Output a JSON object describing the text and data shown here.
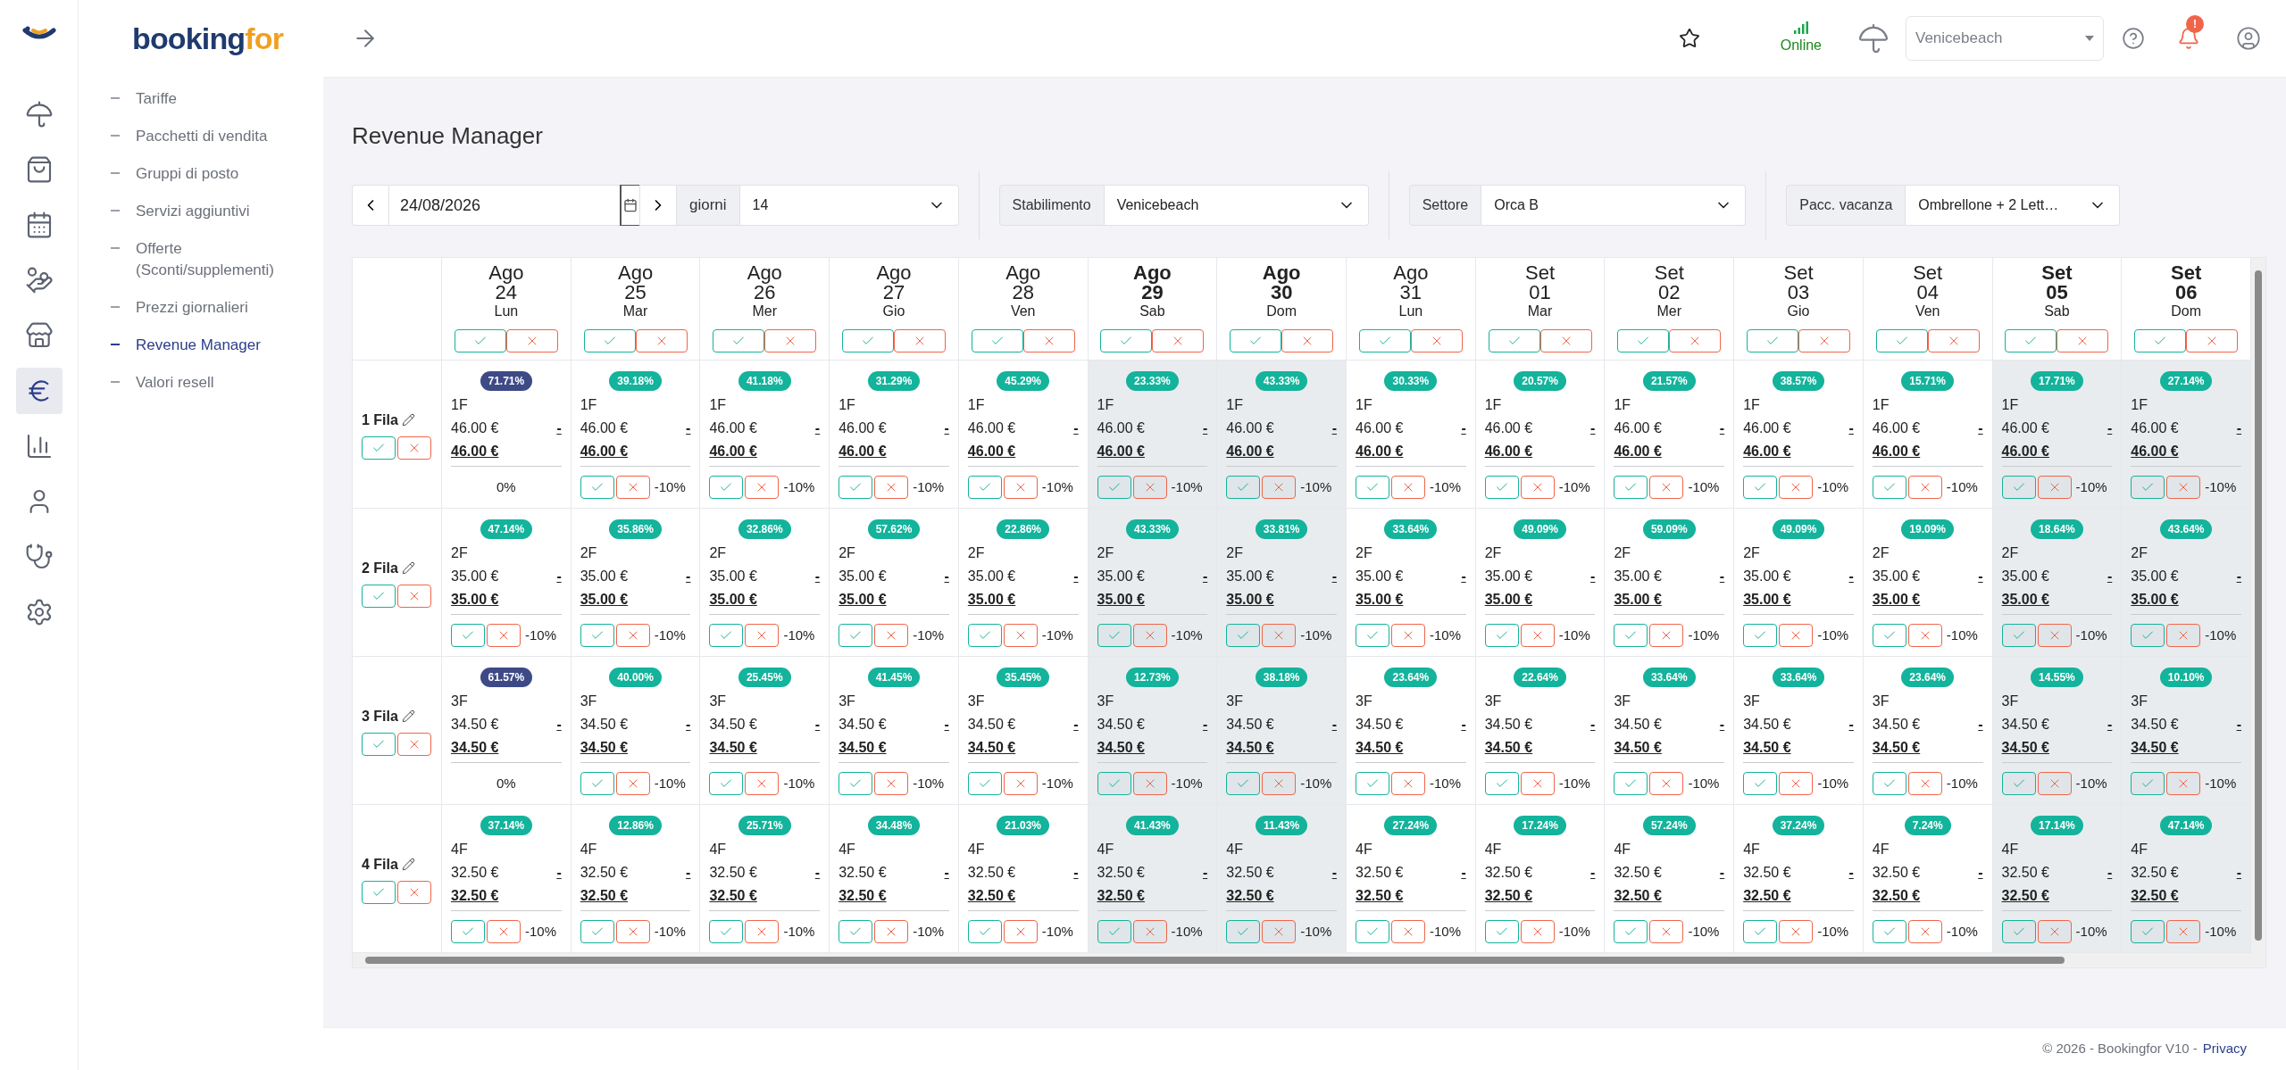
{
  "brand": {
    "dark": "booking",
    "accent": "for"
  },
  "icon_nav": [
    {
      "kind": "umbrella",
      "selected": false
    },
    {
      "kind": "bag",
      "selected": false
    },
    {
      "kind": "calendar",
      "selected": false
    },
    {
      "kind": "coins",
      "selected": false
    },
    {
      "kind": "store",
      "selected": false
    },
    {
      "kind": "euro",
      "selected": true
    },
    {
      "kind": "chart",
      "selected": false
    },
    {
      "kind": "user",
      "selected": false
    },
    {
      "kind": "stethoscope",
      "selected": false
    },
    {
      "kind": "settings",
      "selected": false
    }
  ],
  "submenu": [
    {
      "label": "Tariffe",
      "selected": false
    },
    {
      "label": "Pacchetti di vendita",
      "selected": false
    },
    {
      "label": "Gruppi di posto",
      "selected": false
    },
    {
      "label": "Servizi aggiuntivi",
      "selected": false
    },
    {
      "label": "Offerte (Sconti/supplementi)",
      "selected": false
    },
    {
      "label": "Prezzi giornalieri",
      "selected": false
    },
    {
      "label": "Revenue Manager",
      "selected": true
    },
    {
      "label": "Valori resell",
      "selected": false
    }
  ],
  "header": {
    "status": "Online",
    "facility": "Venicebeach",
    "notification_badge": "!"
  },
  "page_title": "Revenue Manager",
  "filters": {
    "date": "24/08/2026",
    "days_label": "giorni",
    "days": "14",
    "groups": [
      {
        "label": "Stabilimento",
        "value": "Venicebeach"
      },
      {
        "label": "Settore",
        "value": "Orca B"
      },
      {
        "label": "Pacc. vacanza",
        "value": "Ombrellone + 2 Lett…"
      }
    ]
  },
  "columns": [
    {
      "month": "Ago",
      "day": "24",
      "weekday": "Lun",
      "weekend": false
    },
    {
      "month": "Ago",
      "day": "25",
      "weekday": "Mar",
      "weekend": false
    },
    {
      "month": "Ago",
      "day": "26",
      "weekday": "Mer",
      "weekend": false
    },
    {
      "month": "Ago",
      "day": "27",
      "weekday": "Gio",
      "weekend": false
    },
    {
      "month": "Ago",
      "day": "28",
      "weekday": "Ven",
      "weekend": false
    },
    {
      "month": "Ago",
      "day": "29",
      "weekday": "Sab",
      "weekend": true
    },
    {
      "month": "Ago",
      "day": "30",
      "weekday": "Dom",
      "weekend": true
    },
    {
      "month": "Ago",
      "day": "31",
      "weekday": "Lun",
      "weekend": false
    },
    {
      "month": "Set",
      "day": "01",
      "weekday": "Mar",
      "weekend": false
    },
    {
      "month": "Set",
      "day": "02",
      "weekday": "Mer",
      "weekend": false
    },
    {
      "month": "Set",
      "day": "03",
      "weekday": "Gio",
      "weekend": false
    },
    {
      "month": "Set",
      "day": "04",
      "weekday": "Ven",
      "weekend": false
    },
    {
      "month": "Set",
      "day": "05",
      "weekday": "Sab",
      "weekend": true
    },
    {
      "month": "Set",
      "day": "06",
      "weekday": "Dom",
      "weekend": true
    }
  ],
  "rows": [
    {
      "label": "1 Fila",
      "cells": [
        {
          "occupancy": "71.71%",
          "color": "#3d4a86",
          "code": "1F",
          "price": "46.00 €",
          "final": "46.00 €",
          "action": "-",
          "kind": "plain",
          "discount": "0%"
        },
        {
          "occupancy": "39.18%",
          "color": "#14b39b",
          "code": "1F",
          "price": "46.00 €",
          "final": "46.00 €",
          "action": "-",
          "kind": "buttons",
          "discount": "-10%"
        },
        {
          "occupancy": "41.18%",
          "color": "#14b39b",
          "code": "1F",
          "price": "46.00 €",
          "final": "46.00 €",
          "action": "-",
          "kind": "buttons",
          "discount": "-10%"
        },
        {
          "occupancy": "31.29%",
          "color": "#14b39b",
          "code": "1F",
          "price": "46.00 €",
          "final": "46.00 €",
          "action": "-",
          "kind": "buttons",
          "discount": "-10%"
        },
        {
          "occupancy": "45.29%",
          "color": "#14b39b",
          "code": "1F",
          "price": "46.00 €",
          "final": "46.00 €",
          "action": "-",
          "kind": "buttons",
          "discount": "-10%"
        },
        {
          "occupancy": "23.33%",
          "color": "#14b39b",
          "code": "1F",
          "price": "46.00 €",
          "final": "46.00 €",
          "action": "-",
          "kind": "buttons",
          "discount": "-10%"
        },
        {
          "occupancy": "43.33%",
          "color": "#14b39b",
          "code": "1F",
          "price": "46.00 €",
          "final": "46.00 €",
          "action": "-",
          "kind": "buttons",
          "discount": "-10%"
        },
        {
          "occupancy": "30.33%",
          "color": "#14b39b",
          "code": "1F",
          "price": "46.00 €",
          "final": "46.00 €",
          "action": "-",
          "kind": "buttons",
          "discount": "-10%"
        },
        {
          "occupancy": "20.57%",
          "color": "#14b39b",
          "code": "1F",
          "price": "46.00 €",
          "final": "46.00 €",
          "action": "-",
          "kind": "buttons",
          "discount": "-10%"
        },
        {
          "occupancy": "21.57%",
          "color": "#14b39b",
          "code": "1F",
          "price": "46.00 €",
          "final": "46.00 €",
          "action": "-",
          "kind": "buttons",
          "discount": "-10%"
        },
        {
          "occupancy": "38.57%",
          "color": "#14b39b",
          "code": "1F",
          "price": "46.00 €",
          "final": "46.00 €",
          "action": "-",
          "kind": "buttons",
          "discount": "-10%"
        },
        {
          "occupancy": "15.71%",
          "color": "#14b39b",
          "code": "1F",
          "price": "46.00 €",
          "final": "46.00 €",
          "action": "-",
          "kind": "buttons",
          "discount": "-10%"
        },
        {
          "occupancy": "17.71%",
          "color": "#14b39b",
          "code": "1F",
          "price": "46.00 €",
          "final": "46.00 €",
          "action": "-",
          "kind": "buttons",
          "discount": "-10%"
        },
        {
          "occupancy": "27.14%",
          "color": "#14b39b",
          "code": "1F",
          "price": "46.00 €",
          "final": "46.00 €",
          "action": "-",
          "kind": "buttons",
          "discount": "-10%"
        }
      ]
    },
    {
      "label": "2 Fila",
      "cells": [
        {
          "occupancy": "47.14%",
          "color": "#14b39b",
          "code": "2F",
          "price": "35.00 €",
          "final": "35.00 €",
          "action": "-",
          "kind": "buttons",
          "discount": "-10%"
        },
        {
          "occupancy": "35.86%",
          "color": "#14b39b",
          "code": "2F",
          "price": "35.00 €",
          "final": "35.00 €",
          "action": "-",
          "kind": "buttons",
          "discount": "-10%"
        },
        {
          "occupancy": "32.86%",
          "color": "#14b39b",
          "code": "2F",
          "price": "35.00 €",
          "final": "35.00 €",
          "action": "-",
          "kind": "buttons",
          "discount": "-10%"
        },
        {
          "occupancy": "57.62%",
          "color": "#14b39b",
          "code": "2F",
          "price": "35.00 €",
          "final": "35.00 €",
          "action": "-",
          "kind": "buttons",
          "discount": "-10%"
        },
        {
          "occupancy": "22.86%",
          "color": "#14b39b",
          "code": "2F",
          "price": "35.00 €",
          "final": "35.00 €",
          "action": "-",
          "kind": "buttons",
          "discount": "-10%"
        },
        {
          "occupancy": "43.33%",
          "color": "#14b39b",
          "code": "2F",
          "price": "35.00 €",
          "final": "35.00 €",
          "action": "-",
          "kind": "buttons",
          "discount": "-10%"
        },
        {
          "occupancy": "33.81%",
          "color": "#14b39b",
          "code": "2F",
          "price": "35.00 €",
          "final": "35.00 €",
          "action": "-",
          "kind": "buttons",
          "discount": "-10%"
        },
        {
          "occupancy": "33.64%",
          "color": "#14b39b",
          "code": "2F",
          "price": "35.00 €",
          "final": "35.00 €",
          "action": "-",
          "kind": "buttons",
          "discount": "-10%"
        },
        {
          "occupancy": "49.09%",
          "color": "#14b39b",
          "code": "2F",
          "price": "35.00 €",
          "final": "35.00 €",
          "action": "-",
          "kind": "buttons",
          "discount": "-10%"
        },
        {
          "occupancy": "59.09%",
          "color": "#14b39b",
          "code": "2F",
          "price": "35.00 €",
          "final": "35.00 €",
          "action": "-",
          "kind": "buttons",
          "discount": "-10%"
        },
        {
          "occupancy": "49.09%",
          "color": "#14b39b",
          "code": "2F",
          "price": "35.00 €",
          "final": "35.00 €",
          "action": "-",
          "kind": "buttons",
          "discount": "-10%"
        },
        {
          "occupancy": "19.09%",
          "color": "#14b39b",
          "code": "2F",
          "price": "35.00 €",
          "final": "35.00 €",
          "action": "-",
          "kind": "buttons",
          "discount": "-10%"
        },
        {
          "occupancy": "18.64%",
          "color": "#14b39b",
          "code": "2F",
          "price": "35.00 €",
          "final": "35.00 €",
          "action": "-",
          "kind": "buttons",
          "discount": "-10%"
        },
        {
          "occupancy": "43.64%",
          "color": "#14b39b",
          "code": "2F",
          "price": "35.00 €",
          "final": "35.00 €",
          "action": "-",
          "kind": "buttons",
          "discount": "-10%"
        }
      ]
    },
    {
      "label": "3 Fila",
      "cells": [
        {
          "occupancy": "61.57%",
          "color": "#3d4a86",
          "code": "3F",
          "price": "34.50 €",
          "final": "34.50 €",
          "action": "-",
          "kind": "plain",
          "discount": "0%"
        },
        {
          "occupancy": "40.00%",
          "color": "#14b39b",
          "code": "3F",
          "price": "34.50 €",
          "final": "34.50 €",
          "action": "-",
          "kind": "buttons",
          "discount": "-10%"
        },
        {
          "occupancy": "25.45%",
          "color": "#14b39b",
          "code": "3F",
          "price": "34.50 €",
          "final": "34.50 €",
          "action": "-",
          "kind": "buttons",
          "discount": "-10%"
        },
        {
          "occupancy": "41.45%",
          "color": "#14b39b",
          "code": "3F",
          "price": "34.50 €",
          "final": "34.50 €",
          "action": "-",
          "kind": "buttons",
          "discount": "-10%"
        },
        {
          "occupancy": "35.45%",
          "color": "#14b39b",
          "code": "3F",
          "price": "34.50 €",
          "final": "34.50 €",
          "action": "-",
          "kind": "buttons",
          "discount": "-10%"
        },
        {
          "occupancy": "12.73%",
          "color": "#14b39b",
          "code": "3F",
          "price": "34.50 €",
          "final": "34.50 €",
          "action": "-",
          "kind": "buttons",
          "discount": "-10%"
        },
        {
          "occupancy": "38.18%",
          "color": "#14b39b",
          "code": "3F",
          "price": "34.50 €",
          "final": "34.50 €",
          "action": "-",
          "kind": "buttons",
          "discount": "-10%"
        },
        {
          "occupancy": "23.64%",
          "color": "#14b39b",
          "code": "3F",
          "price": "34.50 €",
          "final": "34.50 €",
          "action": "-",
          "kind": "buttons",
          "discount": "-10%"
        },
        {
          "occupancy": "22.64%",
          "color": "#14b39b",
          "code": "3F",
          "price": "34.50 €",
          "final": "34.50 €",
          "action": "-",
          "kind": "buttons",
          "discount": "-10%"
        },
        {
          "occupancy": "33.64%",
          "color": "#14b39b",
          "code": "3F",
          "price": "34.50 €",
          "final": "34.50 €",
          "action": "-",
          "kind": "buttons",
          "discount": "-10%"
        },
        {
          "occupancy": "33.64%",
          "color": "#14b39b",
          "code": "3F",
          "price": "34.50 €",
          "final": "34.50 €",
          "action": "-",
          "kind": "buttons",
          "discount": "-10%"
        },
        {
          "occupancy": "23.64%",
          "color": "#14b39b",
          "code": "3F",
          "price": "34.50 €",
          "final": "34.50 €",
          "action": "-",
          "kind": "buttons",
          "discount": "-10%"
        },
        {
          "occupancy": "14.55%",
          "color": "#14b39b",
          "code": "3F",
          "price": "34.50 €",
          "final": "34.50 €",
          "action": "-",
          "kind": "buttons",
          "discount": "-10%"
        },
        {
          "occupancy": "10.10%",
          "color": "#14b39b",
          "code": "3F",
          "price": "34.50 €",
          "final": "34.50 €",
          "action": "-",
          "kind": "buttons",
          "discount": "-10%"
        }
      ]
    },
    {
      "label": "4 Fila",
      "cells": [
        {
          "occupancy": "37.14%",
          "color": "#14b39b",
          "code": "4F",
          "price": "32.50 €",
          "final": "32.50 €",
          "action": "-",
          "kind": "buttons",
          "discount": "-10%"
        },
        {
          "occupancy": "12.86%",
          "color": "#14b39b",
          "code": "4F",
          "price": "32.50 €",
          "final": "32.50 €",
          "action": "-",
          "kind": "buttons",
          "discount": "-10%"
        },
        {
          "occupancy": "25.71%",
          "color": "#14b39b",
          "code": "4F",
          "price": "32.50 €",
          "final": "32.50 €",
          "action": "-",
          "kind": "buttons",
          "discount": "-10%"
        },
        {
          "occupancy": "34.48%",
          "color": "#14b39b",
          "code": "4F",
          "price": "32.50 €",
          "final": "32.50 €",
          "action": "-",
          "kind": "buttons",
          "discount": "-10%"
        },
        {
          "occupancy": "21.03%",
          "color": "#14b39b",
          "code": "4F",
          "price": "32.50 €",
          "final": "32.50 €",
          "action": "-",
          "kind": "buttons",
          "discount": "-10%"
        },
        {
          "occupancy": "41.43%",
          "color": "#14b39b",
          "code": "4F",
          "price": "32.50 €",
          "final": "32.50 €",
          "action": "-",
          "kind": "buttons",
          "discount": "-10%"
        },
        {
          "occupancy": "11.43%",
          "color": "#14b39b",
          "code": "4F",
          "price": "32.50 €",
          "final": "32.50 €",
          "action": "-",
          "kind": "buttons",
          "discount": "-10%"
        },
        {
          "occupancy": "27.24%",
          "color": "#14b39b",
          "code": "4F",
          "price": "32.50 €",
          "final": "32.50 €",
          "action": "-",
          "kind": "buttons",
          "discount": "-10%"
        },
        {
          "occupancy": "17.24%",
          "color": "#14b39b",
          "code": "4F",
          "price": "32.50 €",
          "final": "32.50 €",
          "action": "-",
          "kind": "buttons",
          "discount": "-10%"
        },
        {
          "occupancy": "57.24%",
          "color": "#14b39b",
          "code": "4F",
          "price": "32.50 €",
          "final": "32.50 €",
          "action": "-",
          "kind": "buttons",
          "discount": "-10%"
        },
        {
          "occupancy": "37.24%",
          "color": "#14b39b",
          "code": "4F",
          "price": "32.50 €",
          "final": "32.50 €",
          "action": "-",
          "kind": "buttons",
          "discount": "-10%"
        },
        {
          "occupancy": "7.24%",
          "color": "#14b39b",
          "code": "4F",
          "price": "32.50 €",
          "final": "32.50 €",
          "action": "-",
          "kind": "buttons",
          "discount": "-10%"
        },
        {
          "occupancy": "17.14%",
          "color": "#14b39b",
          "code": "4F",
          "price": "32.50 €",
          "final": "32.50 €",
          "action": "-",
          "kind": "buttons",
          "discount": "-10%"
        },
        {
          "occupancy": "47.14%",
          "color": "#14b39b",
          "code": "4F",
          "price": "32.50 €",
          "final": "32.50 €",
          "action": "-",
          "kind": "buttons",
          "discount": "-10%"
        }
      ]
    }
  ],
  "footer": {
    "text": "© 2026 - Bookingfor V10 -",
    "link": "Privacy"
  }
}
